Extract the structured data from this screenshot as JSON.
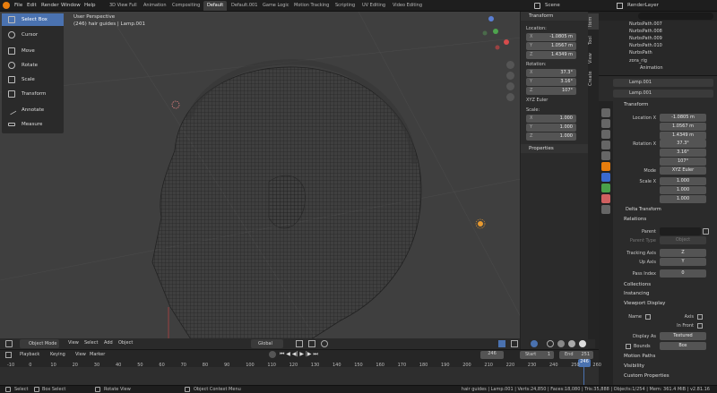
{
  "topbar": {
    "menus": [
      "File",
      "Edit",
      "Render",
      "Window",
      "Help"
    ],
    "workspaces": [
      "3D View Full",
      "Animation",
      "Compositing",
      "Default",
      "Default.001",
      "Game Logic",
      "Motion Tracking",
      "Scripting",
      "UV Editing",
      "Video Editing"
    ],
    "active_workspace": "Default",
    "scene": "Scene",
    "render_layer": "RenderLayer"
  },
  "viewport": {
    "perspective": "User Perspective",
    "object_info": "(246) hair guides | Lamp.001"
  },
  "tools": [
    "Select Box",
    "Cursor",
    "Move",
    "Rotate",
    "Scale",
    "Transform",
    "Annotate",
    "Measure"
  ],
  "npanel": {
    "title": "Transform",
    "location_label": "Location:",
    "location": {
      "x": "-1.0805 m",
      "y": "1.0567 m",
      "z": "1.4349 m"
    },
    "rotation_label": "Rotation:",
    "rotation": {
      "x": "37.3°",
      "y": "3.16°",
      "z": "107°"
    },
    "rotation_mode": "XYZ Euler",
    "scale_label": "Scale:",
    "scale": {
      "x": "1.000",
      "y": "1.000",
      "z": "1.000"
    },
    "properties": "Properties",
    "tabs": [
      "Item",
      "Tool",
      "View",
      "Create"
    ]
  },
  "outliner": {
    "items": [
      "NurbsPath.007",
      "NurbsPath.008",
      "NurbsPath.009",
      "NurbsPath.010",
      "NurbsPath",
      "zora_rig",
      "Animation"
    ]
  },
  "props": {
    "object_name": "Lamp.001",
    "data_name": "Lamp.001",
    "transform": "Transform",
    "location_label": "Location X",
    "location": [
      "-1.0805 m",
      "1.0567 m",
      "1.4349 m"
    ],
    "rotation_label": "Rotation X",
    "rotation": [
      "37.3°",
      "3.16°",
      "107°"
    ],
    "mode_label": "Mode",
    "mode": "XYZ Euler",
    "scale_label": "Scale X",
    "scale": [
      "1.000",
      "1.000",
      "1.000"
    ],
    "delta": "Delta Transform",
    "relations": "Relations",
    "parent_label": "Parent",
    "parent_type_label": "Parent Type",
    "parent_type": "Object",
    "tracking_label": "Tracking Axis",
    "tracking": "Z",
    "up_label": "Up Axis",
    "up": "Y",
    "pass_label": "Pass Index",
    "pass": "0",
    "collections": "Collections",
    "instancing": "Instancing",
    "viewport_display": "Viewport Display",
    "name_label": "Name",
    "axis_label": "Axis",
    "infront_label": "In Front",
    "display_as_label": "Display As",
    "display_as": "Textured",
    "bounds_label": "Bounds",
    "bounds_val": "Box",
    "motion_paths": "Motion Paths",
    "visibility": "Visibility",
    "custom_props": "Custom Properties"
  },
  "header3d": {
    "mode": "Object Mode",
    "menus": [
      "View",
      "Select",
      "Add",
      "Object"
    ],
    "orientation": "Global"
  },
  "timeline": {
    "menus": [
      "Playback",
      "Keying",
      "View",
      "Marker"
    ],
    "current_frame": "246",
    "start_label": "Start",
    "start": "1",
    "end_label": "End",
    "end": "251",
    "ticks": [
      "-10",
      "0",
      "10",
      "20",
      "30",
      "40",
      "50",
      "60",
      "70",
      "80",
      "90",
      "100",
      "110",
      "120",
      "130",
      "140",
      "150",
      "160",
      "170",
      "180",
      "190",
      "200",
      "210",
      "220",
      "230",
      "240",
      "250",
      "260"
    ],
    "playhead": "246"
  },
  "statusbar": {
    "select": "Select",
    "box_select": "Box Select",
    "rotate_view": "Rotate View",
    "context_menu": "Object Context Menu",
    "stats": "hair guides | Lamp.001 | Verts:24,850 | Faces:18,080 | Tris:35,888 | Objects:1/254 | Mem: 361.4 MiB | v2.81.16"
  }
}
